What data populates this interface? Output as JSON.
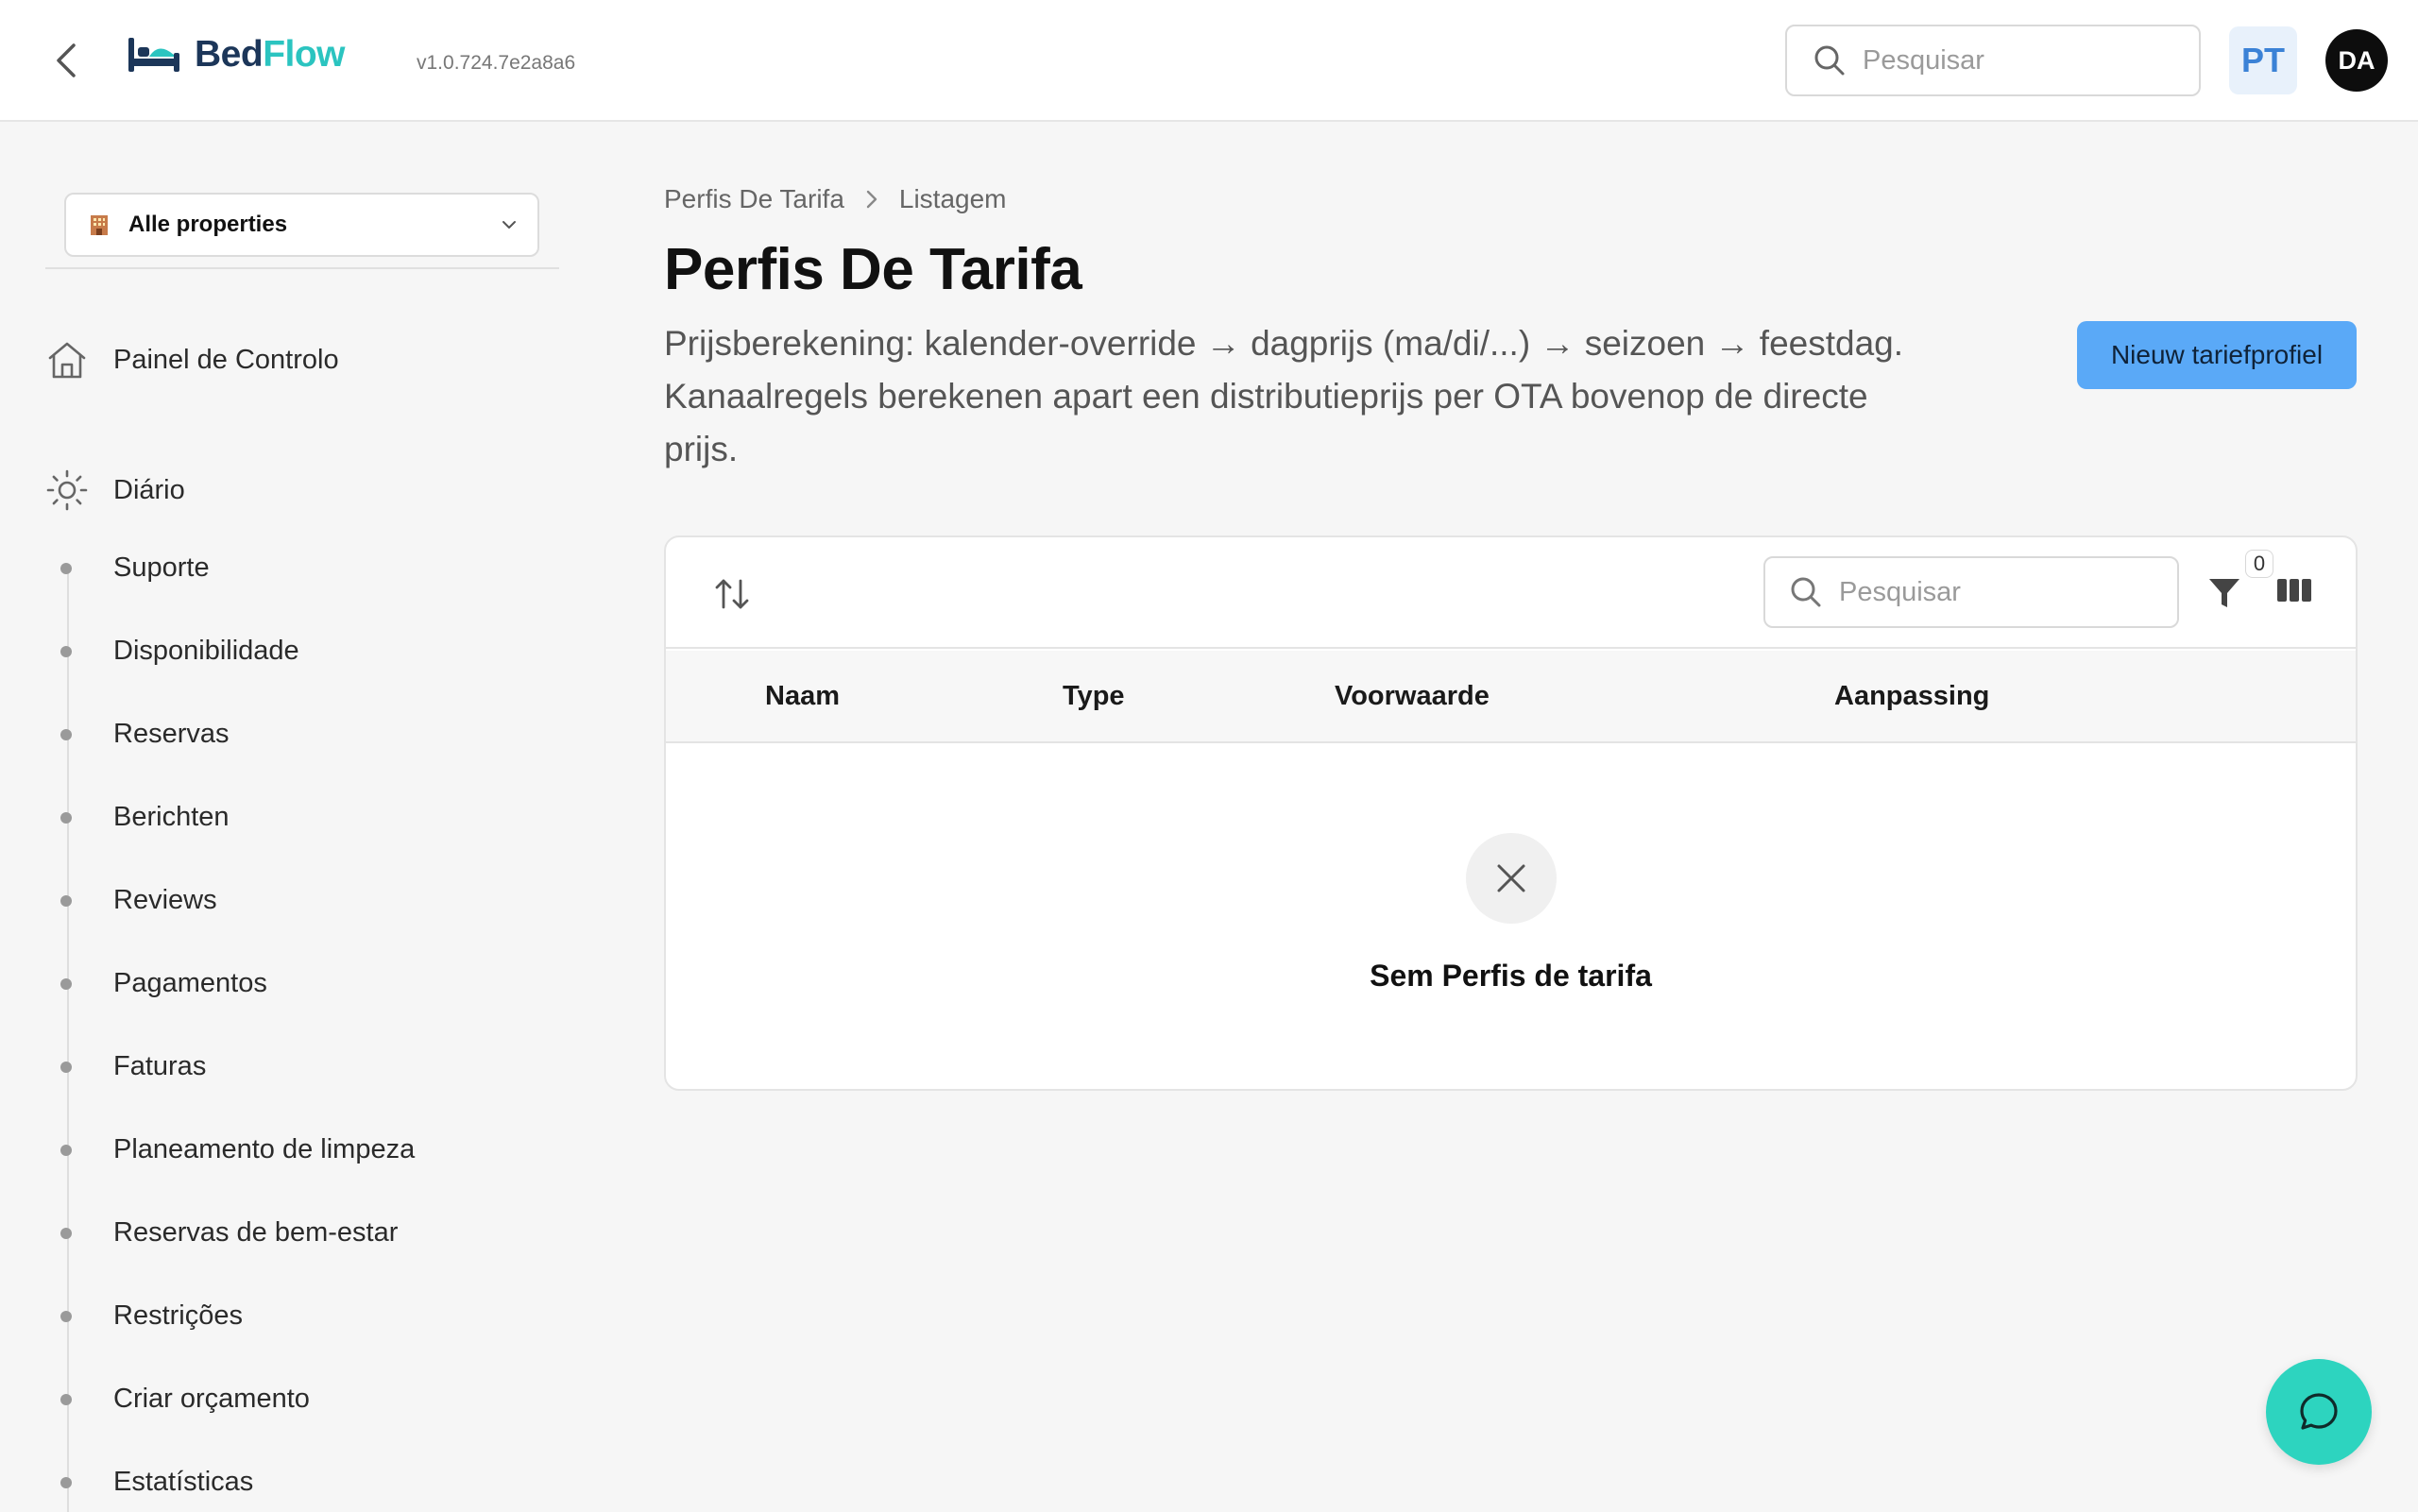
{
  "header": {
    "logo_part1": "Bed",
    "logo_part2": "Flow",
    "version": "v1.0.724.7e2a8a6",
    "search_placeholder": "Pesquisar",
    "language": "PT",
    "user_initials": "DA"
  },
  "sidebar": {
    "property_select": "Alle properties",
    "dashboard": "Painel de Controlo",
    "section": "Diário",
    "items": [
      "Suporte",
      "Disponibilidade",
      "Reservas",
      "Berichten",
      "Reviews",
      "Pagamentos",
      "Faturas",
      "Planeamento de limpeza",
      "Reservas de bem-estar",
      "Restrições",
      "Criar orçamento",
      "Estatísticas"
    ]
  },
  "main": {
    "breadcrumb": [
      "Perfis De Tarifa",
      "Listagem"
    ],
    "title": "Perfis De Tarifa",
    "description": "Prijsberekening: kalender-override → dagprijs (ma/di/...) → seizoen → feestdag. Kanaalregels berekenen apart een distributieprijs per OTA bovenop de directe prijs.",
    "new_button": "Nieuw tariefprofiel",
    "table": {
      "search_placeholder": "Pesquisar",
      "filter_count": "0",
      "columns": [
        "Naam",
        "Type",
        "Voorwaarde",
        "Aanpassing"
      ],
      "empty_message": "Sem Perfis de tarifa"
    }
  },
  "colors": {
    "brand_dark": "#1c3659",
    "brand_teal": "#2bc4c0",
    "primary_button": "#5aa9f7",
    "chat_fab": "#2dd4bf"
  }
}
